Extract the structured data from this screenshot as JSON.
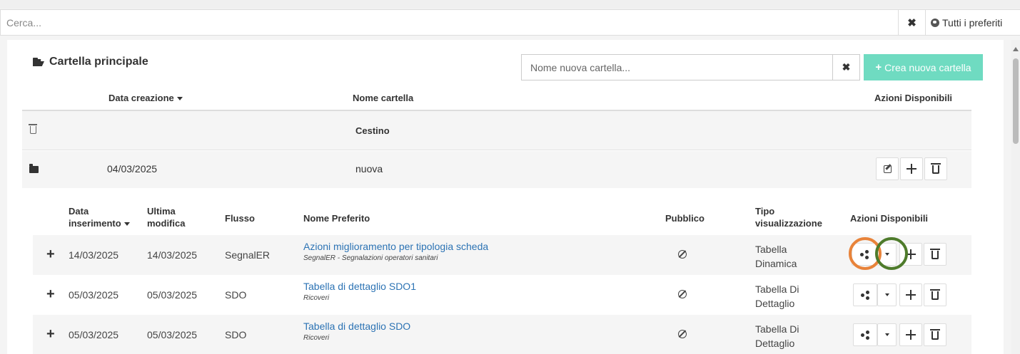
{
  "search": {
    "placeholder": "Cerca...",
    "clear_icon": "times-icon",
    "all_favorites_label": "Tutti i preferiti"
  },
  "folder_panel": {
    "title": "Cartella principale",
    "new_folder_placeholder": "Nome nuova cartella...",
    "create_button_label": "Crea nuova cartella",
    "create_button_color": "#6fdbc1",
    "columns": {
      "date": "Data creazione",
      "name": "Nome cartella",
      "actions": "Azioni Disponibili"
    },
    "rows": [
      {
        "icon": "trash-icon",
        "date": "",
        "name": "Cestino"
      },
      {
        "icon": "folder-icon",
        "date": "04/03/2025",
        "name": "nuova"
      }
    ]
  },
  "favorites": {
    "columns": {
      "inserted_line1": "Data",
      "inserted_line2": "inserimento",
      "modified_line1": "Ultima",
      "modified_line2": "modifica",
      "flow": "Flusso",
      "name": "Nome Preferito",
      "public": "Pubblico",
      "type_line1": "Tipo",
      "type_line2": "visualizzazione",
      "actions": "Azioni Disponibili"
    },
    "rows": [
      {
        "inserted": "14/03/2025",
        "modified": "14/03/2025",
        "flow": "SegnalER",
        "name": "Azioni miglioramento per tipologia scheda",
        "subtitle": "SegnalER - Segnalazioni operatori sanitari",
        "type_line1": "Tabella",
        "type_line2": "Dinamica"
      },
      {
        "inserted": "05/03/2025",
        "modified": "05/03/2025",
        "flow": "SDO",
        "name": "Tabella di dettaglio SDO1",
        "subtitle": "Ricoveri",
        "type_line1": "Tabella Di",
        "type_line2": "Dettaglio"
      },
      {
        "inserted": "05/03/2025",
        "modified": "05/03/2025",
        "flow": "SDO",
        "name": "Tabella di dettaglio SDO",
        "subtitle": "Ricoveri",
        "type_line1": "Tabella Di",
        "type_line2": "Dettaglio"
      }
    ]
  },
  "annotations": {
    "share_ring_color": "#e8833a",
    "dropdown_ring_color": "#4e7b2b"
  },
  "colors": {
    "link": "#2c73b4",
    "row_alt": "#f5f5f5"
  }
}
